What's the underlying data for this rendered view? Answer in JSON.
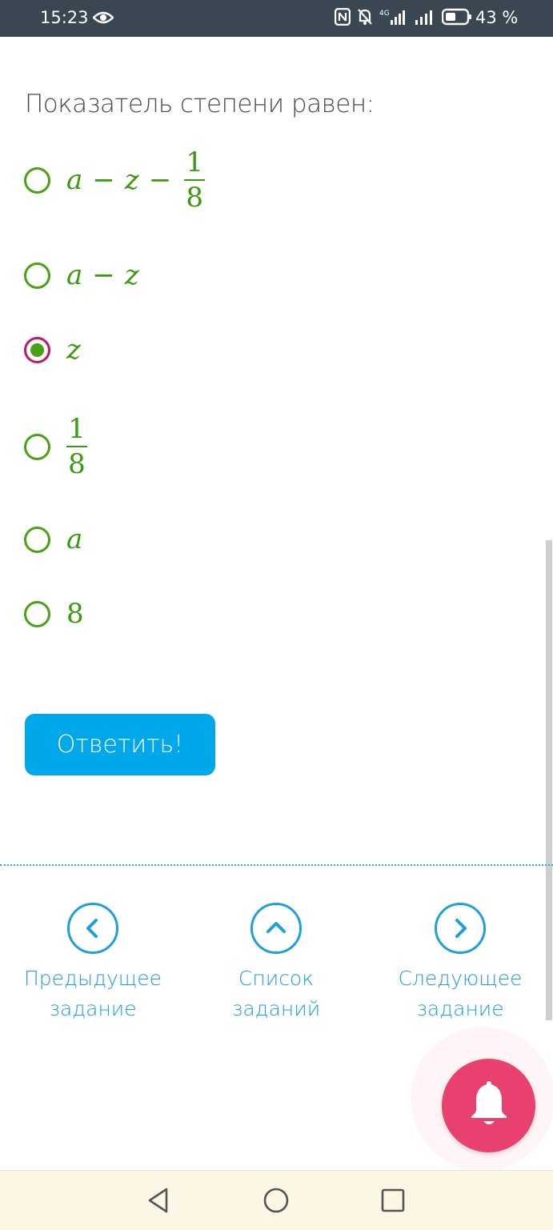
{
  "status_bar": {
    "time": "15:23",
    "battery_percent": "43 %",
    "icons": [
      "eye-icon",
      "nfc-icon",
      "mute-bell-icon",
      "signal-4g-icon",
      "signal-icon",
      "battery-icon"
    ]
  },
  "question": {
    "text": "Показатель степени равен:"
  },
  "options": [
    {
      "parts": [
        "a",
        "−",
        "z",
        "−"
      ],
      "fraction": {
        "num": "1",
        "den": "8"
      },
      "selected": false
    },
    {
      "parts": [
        "a",
        "−",
        "z"
      ],
      "selected": false
    },
    {
      "parts": [
        "z"
      ],
      "selected": true
    },
    {
      "parts": [],
      "fraction": {
        "num": "1",
        "den": "8"
      },
      "selected": false
    },
    {
      "parts": [
        "a"
      ],
      "selected": false
    },
    {
      "parts": [
        "8"
      ],
      "selected": false
    }
  ],
  "answer_button": {
    "label": "Ответить!"
  },
  "navigation": {
    "prev": {
      "line1": "Предыдущее",
      "line2": "задание"
    },
    "list": {
      "line1": "Список",
      "line2": "заданий"
    },
    "next": {
      "line1": "Следующее",
      "line2": "задание"
    }
  },
  "colors": {
    "accent_green": "#3a9a10",
    "selected_ring": "#c0166b",
    "button_blue": "#00a8ea",
    "nav_blue": "#1ea0d8",
    "bell_pink": "#e8416f"
  }
}
